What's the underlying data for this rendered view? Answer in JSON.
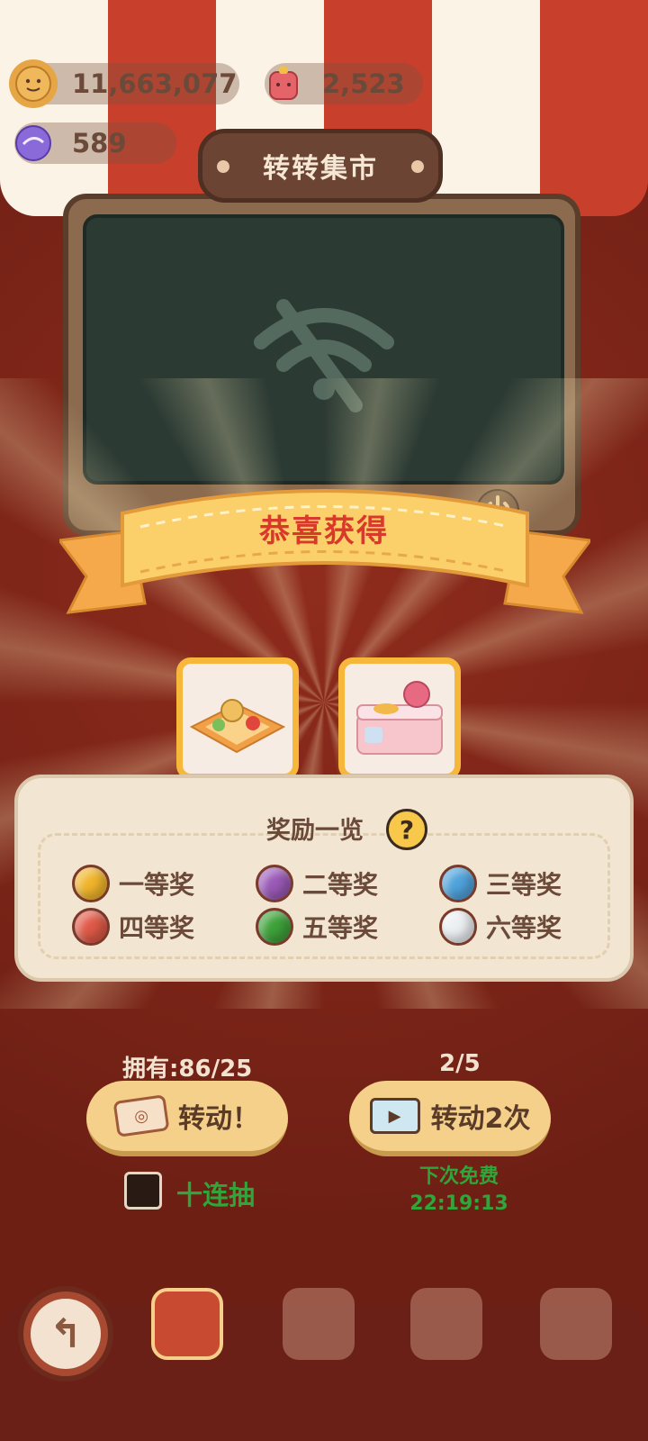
{
  "currencies": {
    "cookies": "11,663,077",
    "candy": "2,523",
    "gems": "589"
  },
  "icons": {
    "cookie": "cookie-icon",
    "candy": "candy-icon",
    "gem": "gem-icon",
    "wifi": "wifi-off-icon",
    "power": "power-icon",
    "help": "help-icon",
    "ticket": "ticket-icon",
    "video": "video-icon",
    "back": "back-arrow-icon"
  },
  "machine": {
    "title": "转转集市"
  },
  "banner": {
    "text": "恭喜获得"
  },
  "rewards_list": {
    "title": "奖励一览",
    "help": "?",
    "tiers": [
      {
        "label": "一等奖",
        "color": "#f1b52b"
      },
      {
        "label": "二等奖",
        "color": "#9b5ab8"
      },
      {
        "label": "三等奖",
        "color": "#4fa3dc"
      },
      {
        "label": "四等奖",
        "color": "#e05a48"
      },
      {
        "label": "五等奖",
        "color": "#3ea23a"
      },
      {
        "label": "六等奖",
        "color": "#eceff2"
      }
    ]
  },
  "controls": {
    "owned": "拥有:86/25",
    "free_count": "2/5",
    "spin_label": "转动！",
    "spin_twice_label": "转动2次",
    "ten_draw_label": "十连抽",
    "next_free_label": "下次免费",
    "next_free_time": "22:19:13"
  },
  "colors": {
    "accent_green": "#2fa63a",
    "button_yellow": "#f4d08a",
    "card_border": "#f7b73a"
  }
}
